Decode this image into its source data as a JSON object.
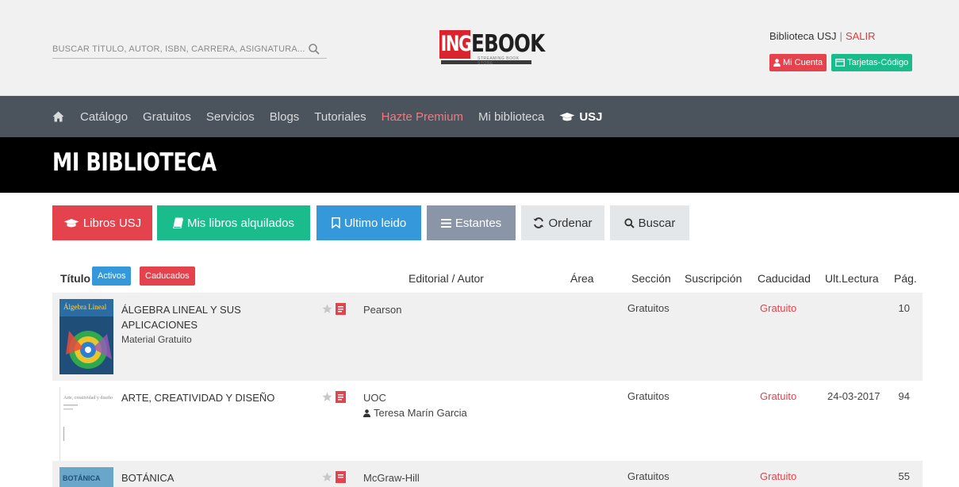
{
  "search": {
    "placeholder": "BUSCAR TÍTULO, AUTOR, ISBN, CARRERA, ASIGNATURA..."
  },
  "logo": {
    "part1": "ING",
    "part2": "EBOOK",
    "tagline": "STREAMING BOOK STORE"
  },
  "user": {
    "library": "Biblioteca USJ",
    "separator": "|",
    "logout": "SALIR",
    "account_label": "Mi Cuenta",
    "cards_label": "Tarjetas-Código"
  },
  "nav": {
    "items": [
      "Catálogo",
      "Gratuitos",
      "Servicios",
      "Blogs",
      "Tutoriales",
      "Hazte Premium",
      "Mi biblioteca",
      "USJ"
    ]
  },
  "page": {
    "title": "MI BIBLIOTECA"
  },
  "filters": {
    "usj": "Libros USJ",
    "rented": "Mis libros alquilados",
    "last": "Ultimo leido",
    "shelves": "Estantes",
    "order": "Ordenar",
    "search": "Buscar"
  },
  "table": {
    "headers": {
      "title": "Título",
      "active": "Activos",
      "expired": "Caducados",
      "publisher": "Editorial / Autor",
      "area": "Área",
      "section": "Sección",
      "subscription": "Suscripción",
      "expiry": "Caducidad",
      "last_read": "Ult.Lectura",
      "pages": "Pág."
    },
    "rows": [
      {
        "title": "ÁLGEBRA LINEAL Y SUS APLICACIONES",
        "subtitle": "Material Gratuito",
        "publisher": "Pearson",
        "author": "",
        "section": "Gratuitos",
        "expiry": "Gratuito",
        "last_read": "",
        "pages": "10",
        "cover_text": "Álgebra Lineal"
      },
      {
        "title": "ARTE, CREATIVIDAD Y DISEÑO",
        "subtitle": "",
        "publisher": "UOC",
        "author": "Teresa Marín Garcia",
        "section": "Gratuitos",
        "expiry": "Gratuito",
        "last_read": "24-03-2017",
        "pages": "94",
        "cover_text": "Arte, creatividad y diseño"
      },
      {
        "title": "BOTÁNICA",
        "subtitle": "",
        "publisher": "McGraw-Hill",
        "author": "",
        "section": "Gratuitos",
        "expiry": "Gratuito",
        "last_read": "",
        "pages": "55",
        "cover_text": "BOTÁNICA"
      }
    ]
  },
  "colors": {
    "red": "#e4424d",
    "green": "#1bbc8c",
    "blue": "#3498db",
    "nav_bg": "#4b535c",
    "slate": "#8a96a7"
  },
  "icons": [
    "search-icon",
    "home-icon",
    "graduation-cap-icon",
    "user-icon",
    "card-icon",
    "book-icon",
    "bookmark-icon",
    "list-icon",
    "refresh-icon",
    "star-icon",
    "pdf-icon"
  ]
}
